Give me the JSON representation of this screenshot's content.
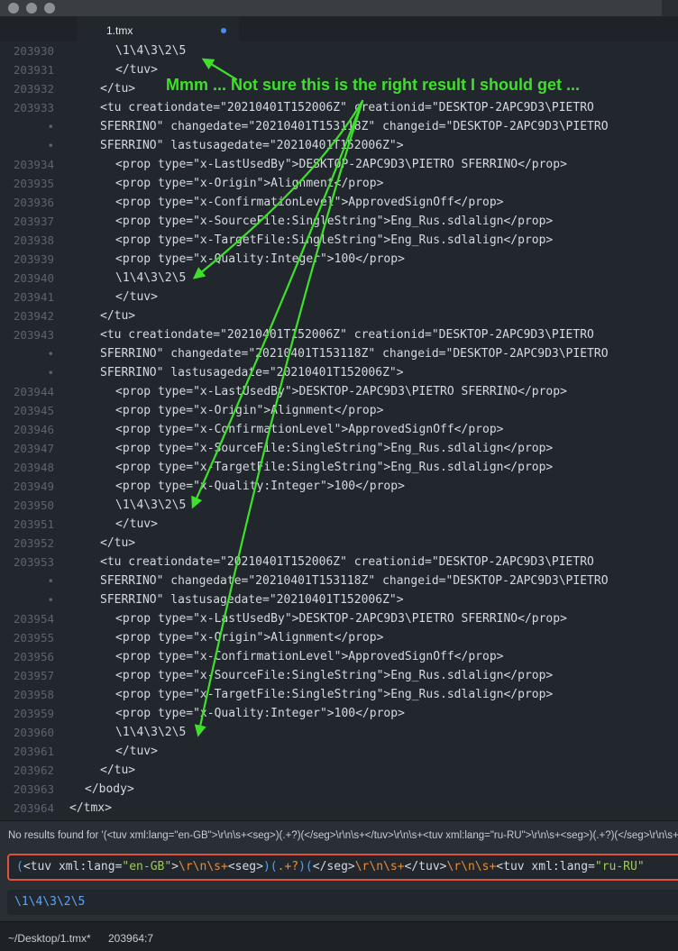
{
  "tab": {
    "title": "1.tmx"
  },
  "editor": {
    "lines": [
      {
        "num": "203930",
        "indent": 3,
        "text": "\\1\\4\\3\\2\\5"
      },
      {
        "num": "203931",
        "indent": 3,
        "text": "</tuv>"
      },
      {
        "num": "203932",
        "indent": 2,
        "text": "</tu>"
      },
      {
        "num": "203933",
        "indent": 2,
        "text": "<tu creationdate=\"20210401T152006Z\" creationid=\"DESKTOP-2APC9D3\\PIETRO"
      },
      {
        "num": "•",
        "indent": 2,
        "text": "SFERRINO\" changedate=\"20210401T153118Z\" changeid=\"DESKTOP-2APC9D3\\PIETRO"
      },
      {
        "num": "•",
        "indent": 2,
        "text": "SFERRINO\" lastusagedate=\"20210401T152006Z\">"
      },
      {
        "num": "203934",
        "indent": 3,
        "text": "<prop type=\"x-LastUsedBy\">DESKTOP-2APC9D3\\PIETRO SFERRINO</prop>"
      },
      {
        "num": "203935",
        "indent": 3,
        "text": "<prop type=\"x-Origin\">Alignment</prop>"
      },
      {
        "num": "203936",
        "indent": 3,
        "text": "<prop type=\"x-ConfirmationLevel\">ApprovedSignOff</prop>"
      },
      {
        "num": "203937",
        "indent": 3,
        "text": "<prop type=\"x-SourceFile:SingleString\">Eng_Rus.sdlalign</prop>"
      },
      {
        "num": "203938",
        "indent": 3,
        "text": "<prop type=\"x-TargetFile:SingleString\">Eng_Rus.sdlalign</prop>"
      },
      {
        "num": "203939",
        "indent": 3,
        "text": "<prop type=\"x-Quality:Integer\">100</prop>"
      },
      {
        "num": "203940",
        "indent": 3,
        "text": "\\1\\4\\3\\2\\5"
      },
      {
        "num": "203941",
        "indent": 3,
        "text": "</tuv>"
      },
      {
        "num": "203942",
        "indent": 2,
        "text": "</tu>"
      },
      {
        "num": "203943",
        "indent": 2,
        "text": "<tu creationdate=\"20210401T152006Z\" creationid=\"DESKTOP-2APC9D3\\PIETRO"
      },
      {
        "num": "•",
        "indent": 2,
        "text": "SFERRINO\" changedate=\"20210401T153118Z\" changeid=\"DESKTOP-2APC9D3\\PIETRO"
      },
      {
        "num": "•",
        "indent": 2,
        "text": "SFERRINO\" lastusagedate=\"20210401T152006Z\">"
      },
      {
        "num": "203944",
        "indent": 3,
        "text": "<prop type=\"x-LastUsedBy\">DESKTOP-2APC9D3\\PIETRO SFERRINO</prop>"
      },
      {
        "num": "203945",
        "indent": 3,
        "text": "<prop type=\"x-Origin\">Alignment</prop>"
      },
      {
        "num": "203946",
        "indent": 3,
        "text": "<prop type=\"x-ConfirmationLevel\">ApprovedSignOff</prop>"
      },
      {
        "num": "203947",
        "indent": 3,
        "text": "<prop type=\"x-SourceFile:SingleString\">Eng_Rus.sdlalign</prop>"
      },
      {
        "num": "203948",
        "indent": 3,
        "text": "<prop type=\"x-TargetFile:SingleString\">Eng_Rus.sdlalign</prop>"
      },
      {
        "num": "203949",
        "indent": 3,
        "text": "<prop type=\"x-Quality:Integer\">100</prop>"
      },
      {
        "num": "203950",
        "indent": 3,
        "text": "\\1\\4\\3\\2\\5"
      },
      {
        "num": "203951",
        "indent": 3,
        "text": "</tuv>"
      },
      {
        "num": "203952",
        "indent": 2,
        "text": "</tu>"
      },
      {
        "num": "203953",
        "indent": 2,
        "text": "<tu creationdate=\"20210401T152006Z\" creationid=\"DESKTOP-2APC9D3\\PIETRO"
      },
      {
        "num": "•",
        "indent": 2,
        "text": "SFERRINO\" changedate=\"20210401T153118Z\" changeid=\"DESKTOP-2APC9D3\\PIETRO"
      },
      {
        "num": "•",
        "indent": 2,
        "text": "SFERRINO\" lastusagedate=\"20210401T152006Z\">"
      },
      {
        "num": "203954",
        "indent": 3,
        "text": "<prop type=\"x-LastUsedBy\">DESKTOP-2APC9D3\\PIETRO SFERRINO</prop>"
      },
      {
        "num": "203955",
        "indent": 3,
        "text": "<prop type=\"x-Origin\">Alignment</prop>"
      },
      {
        "num": "203956",
        "indent": 3,
        "text": "<prop type=\"x-ConfirmationLevel\">ApprovedSignOff</prop>"
      },
      {
        "num": "203957",
        "indent": 3,
        "text": "<prop type=\"x-SourceFile:SingleString\">Eng_Rus.sdlalign</prop>"
      },
      {
        "num": "203958",
        "indent": 3,
        "text": "<prop type=\"x-TargetFile:SingleString\">Eng_Rus.sdlalign</prop>"
      },
      {
        "num": "203959",
        "indent": 3,
        "text": "<prop type=\"x-Quality:Integer\">100</prop>"
      },
      {
        "num": "203960",
        "indent": 3,
        "text": "\\1\\4\\3\\2\\5"
      },
      {
        "num": "203961",
        "indent": 3,
        "text": "</tuv>"
      },
      {
        "num": "203962",
        "indent": 2,
        "text": "</tu>"
      },
      {
        "num": "203963",
        "indent": 1,
        "text": "</body>"
      },
      {
        "num": "203964",
        "indent": 0,
        "text": "</tmx>"
      }
    ]
  },
  "annotation": {
    "text": "Mmm ... Not sure this is the right result I should get ...",
    "color": "#3ee02b"
  },
  "find": {
    "status": "No results found for '(<tuv xml:lang=\"en-GB\">\\r\\n\\s+<seg>)(.+?)(</seg>\\r\\n\\s+</tuv>\\r\\n\\s+<tuv xml:lang=\"ru-RU\">\\r\\n\\s+<seg>)(.+?)(</seg>\\r\\n\\s+</tuv>",
    "query_parts": [
      {
        "t": "(",
        "c": "grp"
      },
      {
        "t": "<tuv xml:lang=",
        "c": "tok"
      },
      {
        "t": "\"en-GB\"",
        "c": "q"
      },
      {
        "t": ">",
        "c": "tok"
      },
      {
        "t": "\\r\\n\\s",
        "c": "esc"
      },
      {
        "t": "+",
        "c": "op"
      },
      {
        "t": "<seg>",
        "c": "tok"
      },
      {
        "t": ")(",
        "c": "grp"
      },
      {
        "t": ".+?",
        "c": "op"
      },
      {
        "t": ")(",
        "c": "grp"
      },
      {
        "t": "</seg>",
        "c": "tok"
      },
      {
        "t": "\\r\\n\\s",
        "c": "esc"
      },
      {
        "t": "+",
        "c": "op"
      },
      {
        "t": "</tuv>",
        "c": "tok"
      },
      {
        "t": "\\r\\n\\s",
        "c": "esc"
      },
      {
        "t": "+",
        "c": "op"
      },
      {
        "t": "<tuv xml:lang=",
        "c": "tok"
      },
      {
        "t": "\"ru-RU\"",
        "c": "q"
      }
    ],
    "replace_value": "\\1\\4\\3\\2\\5",
    "border_color": "#e0503f"
  },
  "status": {
    "path": "~/Desktop/1.tmx*",
    "position": "203964:7"
  }
}
